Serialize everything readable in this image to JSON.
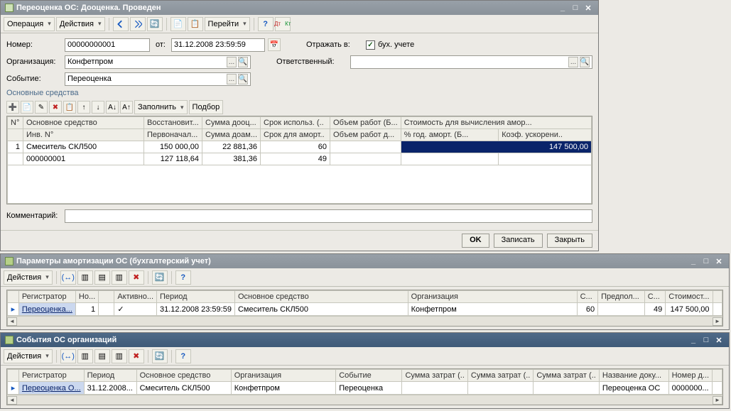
{
  "win1": {
    "title": "Переоценка ОС: Дооценка. Проведен",
    "toolbar": {
      "op": "Операция",
      "actions": "Действия",
      "goto": "Перейти"
    },
    "labels": {
      "number": "Номер:",
      "org": "Организация:",
      "event": "Событие:",
      "from": "от:",
      "reflect": "Отражать в:",
      "resps": "Ответственный:",
      "bu": "бух. учете",
      "comment": "Комментарий:",
      "main_assets": "Основные средства",
      "fill": "Заполнить",
      "select": "Подбор"
    },
    "values": {
      "number": "00000000001",
      "date": "31.12.2008 23:59:59",
      "org": "Конфетпром",
      "event": "Переоценка"
    },
    "grid": {
      "head1": {
        "n": "N°",
        "os": "Основное средство",
        "v": "Восстановит...",
        "sd": "Сумма дооц...",
        "si": "Срок использ. (..",
        "ob": "Объем работ (Б...",
        "st": "Стоимость для вычисления амор..."
      },
      "head2": {
        "inv": "Инв. N°",
        "p": "Первоначал...",
        "sda": "Сумма доам...",
        "sa": "Срок для аморт..",
        "obd": "Объем работ д...",
        "pg": "% год. аморт. (Б...",
        "ku": "Коэф. ускорени.."
      },
      "rows": [
        {
          "n": "1",
          "os": "Смеситель СКЛ500",
          "v": "150 000,00",
          "sd": "22 881,36",
          "si": "60",
          "ob": "",
          "st": "147 500,00"
        },
        {
          "n": "",
          "os": "000000001",
          "v": "127 118,64",
          "sd": "381,36",
          "si": "49",
          "ob": "",
          "st": ""
        }
      ]
    },
    "buttons": {
      "ok": "OK",
      "save": "Записать",
      "close": "Закрыть"
    }
  },
  "win2": {
    "title": "Параметры амортизации ОС (бухгалтерский учет)",
    "toolbar": {
      "actions": "Действия"
    },
    "head": {
      "reg": "Регистратор",
      "no": "Но...",
      "act": "Активно...",
      "per": "Период",
      "os": "Основное средство",
      "org": "Организация",
      "c": "С...",
      "pre": "Предпол...",
      "cc": "С...",
      "st": "Стоимост..."
    },
    "row": {
      "reg": "Переоценка...",
      "no": "1",
      "act": "✓",
      "per": "31.12.2008 23:59:59",
      "os": "Смеситель СКЛ500",
      "org": "Конфетпром",
      "c": "60",
      "pre": "",
      "cc": "49",
      "st": "147 500,00"
    }
  },
  "win3": {
    "title": "События ОС организаций",
    "toolbar": {
      "actions": "Действия"
    },
    "head": {
      "reg": "Регистратор",
      "per": "Период",
      "os": "Основное средство",
      "org": "Организация",
      "ev": "Событие",
      "sz1": "Сумма затрат (..",
      "sz2": "Сумма затрат (..",
      "sz3": "Сумма затрат (..",
      "nd": "Название доку...",
      "nmd": "Номер д..."
    },
    "row": {
      "reg": "Переоценка О...",
      "per": "31.12.2008...",
      "os": "Смеситель СКЛ500",
      "org": "Конфетпром",
      "ev": "Переоценка",
      "sz1": "",
      "sz2": "",
      "sz3": "",
      "nd": "Переоценка ОС",
      "nmd": "0000000..."
    }
  }
}
